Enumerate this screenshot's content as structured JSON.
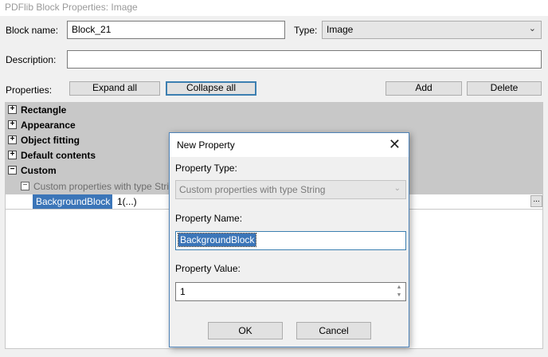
{
  "window": {
    "title": "PDFlib Block Properties: Image"
  },
  "form": {
    "block_name_label": "Block name:",
    "block_name_value": "Block_21",
    "type_label": "Type:",
    "type_value": "Image",
    "description_label": "Description:",
    "description_value": "",
    "properties_label": "Properties:"
  },
  "toolbar": {
    "expand_all": "Expand all",
    "collapse_all": "Collapse all",
    "add": "Add",
    "delete": "Delete"
  },
  "tree": {
    "groups": [
      {
        "label": "Rectangle",
        "expander": "+"
      },
      {
        "label": "Appearance",
        "expander": "+"
      },
      {
        "label": "Object fitting",
        "expander": "+"
      },
      {
        "label": "Default contents",
        "expander": "+"
      },
      {
        "label": "Custom",
        "expander": "−"
      }
    ],
    "subgroup": {
      "label": "Custom properties with type Stri",
      "expander": "−"
    },
    "property": {
      "name": "BackgroundBlock",
      "value": "1(...)",
      "ellipsis": "..."
    }
  },
  "dialog": {
    "title": "New Property",
    "close": "✕",
    "property_type_label": "Property Type:",
    "property_type_value": "Custom properties with type String",
    "property_name_label": "Property Name:",
    "property_name_value": "BackgroundBlock",
    "property_value_label": "Property Value:",
    "property_value_value": "1",
    "ok": "OK",
    "cancel": "Cancel"
  },
  "icons": {
    "dropdown": "chevron-down-icon",
    "close": "close-icon",
    "spin": "spinner-arrows-icon"
  },
  "colors": {
    "selection": "#3b75b8",
    "tree_group_bg": "#c8c8c8",
    "focus_border": "#3c7fb1"
  }
}
